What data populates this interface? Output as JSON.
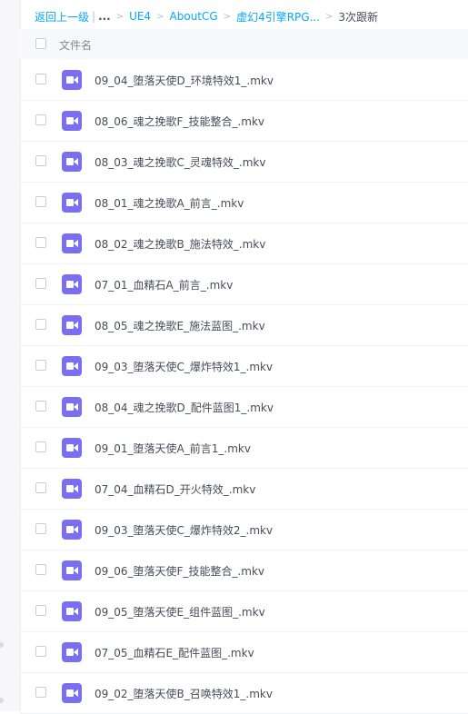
{
  "breadcrumb": {
    "back": "返回上一级",
    "more": "...",
    "items": [
      "UE4",
      "AboutCG",
      "虚幻4引擎RPG...",
      "3次跟新"
    ]
  },
  "list_header": {
    "column_name": "文件名"
  },
  "files": [
    {
      "name": "09_04_堕落天使D_环境特效1_.mkv"
    },
    {
      "name": "08_06_魂之挽歌F_技能整合_.mkv"
    },
    {
      "name": "08_03_魂之挽歌C_灵魂特效_.mkv"
    },
    {
      "name": "08_01_魂之挽歌A_前言_.mkv"
    },
    {
      "name": "08_02_魂之挽歌B_施法特效_.mkv"
    },
    {
      "name": "07_01_血精石A_前言_.mkv"
    },
    {
      "name": "08_05_魂之挽歌E_施法蓝图_.mkv"
    },
    {
      "name": "09_03_堕落天使C_爆炸特效1_.mkv"
    },
    {
      "name": "08_04_魂之挽歌D_配件蓝图1_.mkv"
    },
    {
      "name": "09_01_堕落天使A_前言1_.mkv"
    },
    {
      "name": "07_04_血精石D_开火特效_.mkv"
    },
    {
      "name": "09_03_堕落天使C_爆炸特效2_.mkv"
    },
    {
      "name": "09_06_堕落天使F_技能整合_.mkv"
    },
    {
      "name": "09_05_堕落天使E_组件蓝图_.mkv"
    },
    {
      "name": "07_05_血精石E_配件蓝图_.mkv"
    },
    {
      "name": "09_02_堕落天使B_召唤特效1_.mkv"
    }
  ],
  "icons": {
    "file_type": "video-file-icon"
  },
  "colors": {
    "accent": "#06a7ff",
    "video_icon": "#7a6ff0"
  }
}
